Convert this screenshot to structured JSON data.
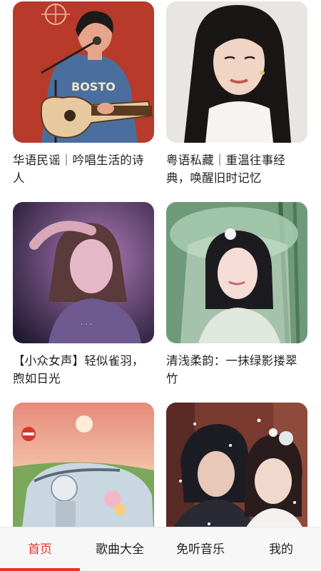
{
  "playlists": [
    {
      "title": "华语民谣｜吟唱生活的诗人",
      "image": "singer-guitar-illustration"
    },
    {
      "title": "粤语私藏｜重温往事经典，唤醒旧时记忆",
      "image": "woman-long-black-hair-portrait"
    },
    {
      "title": "【小众女声】轻似雀羽，煦如日光",
      "image": "girl-purple-light-portrait"
    },
    {
      "title": "清浅柔韵：一抹绿影搂翠竹",
      "image": "woman-green-veil-bamboo"
    },
    {
      "title": "",
      "image": "sunset-convertible-car"
    },
    {
      "title": "",
      "image": "ancient-costume-couple-snow"
    }
  ],
  "tabs": {
    "home": "首页",
    "songs": "歌曲大全",
    "free": "免听音乐",
    "mine": "我的"
  },
  "colors": {
    "accent": "#e8332a",
    "text": "#1f1f1f",
    "tabbar_bg": "#f7f7f7"
  }
}
